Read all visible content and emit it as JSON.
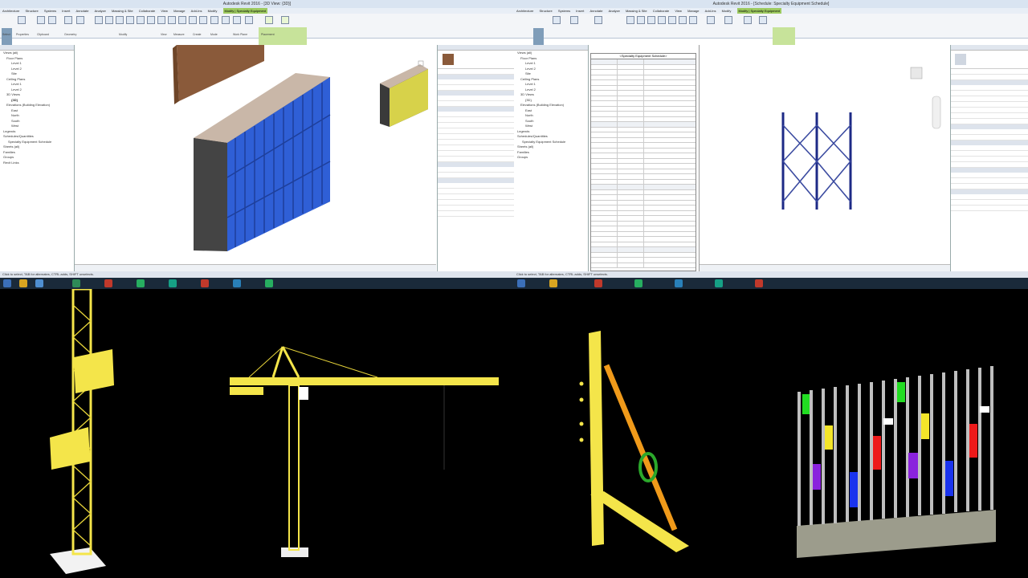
{
  "left_window": {
    "title": "Autodesk Revit 2016 - [3D View: {3D}]",
    "menu": [
      "Architecture",
      "Structure",
      "Systems",
      "Insert",
      "Annotate",
      "Analyze",
      "Massing & Site",
      "Collaborate",
      "View",
      "Manage",
      "Add-Ins",
      "Modify",
      "Modify | Specialty Equipment"
    ],
    "ribbon_groups": [
      "Select",
      "Properties",
      "Clipboard",
      "Geometry",
      "Modify",
      "View",
      "Measure",
      "Create",
      "Mode",
      "Work Plane",
      "Placement"
    ],
    "browser_items": [
      "Views (all)",
      "Floor Plans",
      "Level 1",
      "Level 2",
      "Site",
      "Ceiling Plans",
      "Level 1",
      "Level 2",
      "3D Views",
      "{3D}",
      "Elevations (Building Elevation)",
      "East",
      "North",
      "South",
      "West",
      "Legends",
      "Schedules/Quantities",
      "Specialty Equipment Schedule",
      "Sheets (all)",
      "Families",
      "Groups",
      "Revit Links"
    ],
    "status": "Click to select, TAB for alternates, CTRL adds, SHIFT unselects."
  },
  "right_window": {
    "title": "Autodesk Revit 2016 - [Schedule: Specialty Equipment Schedule]",
    "schedule_title": "<Specialty Equipment Schedule>",
    "status": "Click to select, TAB for alternates, CTRL adds, SHIFT unselects."
  },
  "colors": {
    "ribbon_accent": "#9ecb60",
    "formwork_blue": "#2f5fd6",
    "equipment_yellow": "#f4e54a"
  },
  "icons": [
    "folder-icon",
    "window-icon",
    "search-icon",
    "crane-icon",
    "hoist-icon",
    "brace-icon",
    "rebar-icon"
  ]
}
